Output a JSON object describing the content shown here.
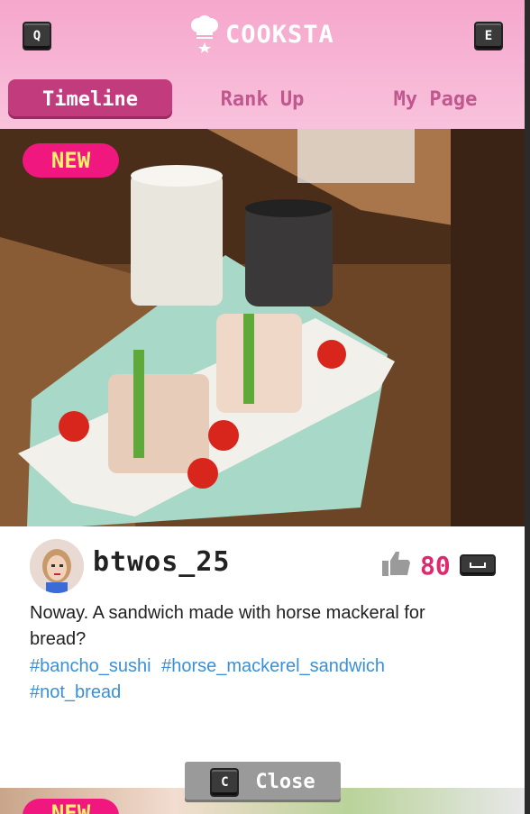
{
  "app": {
    "name": "COOKSTA",
    "left_key": "Q",
    "right_key": "E"
  },
  "tabs": [
    {
      "label": "Timeline",
      "active": true
    },
    {
      "label": "Rank Up",
      "active": false
    },
    {
      "label": "My Page",
      "active": false
    }
  ],
  "post": {
    "badge": "NEW",
    "username": "btwos_25",
    "likes": "80",
    "caption": "Noway. A sandwich made with horse mackeral for bread?",
    "hashtags": [
      "#bancho_sushi",
      "#horse_mackerel_sandwich",
      "#not_bread"
    ]
  },
  "footer": {
    "close_key": "C",
    "close_label": "Close",
    "next_badge": "NEW"
  },
  "colors": {
    "header_pink": "#f6a7cc",
    "active_tab": "#c23b7c",
    "tab_text": "#c0578f",
    "badge": "#f0177f",
    "badge_text": "#fff36b",
    "like_count": "#e0286f",
    "hashtag": "#3a8fd6"
  },
  "icons": [
    "chef-hat-icon",
    "thumbs-up-icon",
    "spacebar-key-icon"
  ]
}
